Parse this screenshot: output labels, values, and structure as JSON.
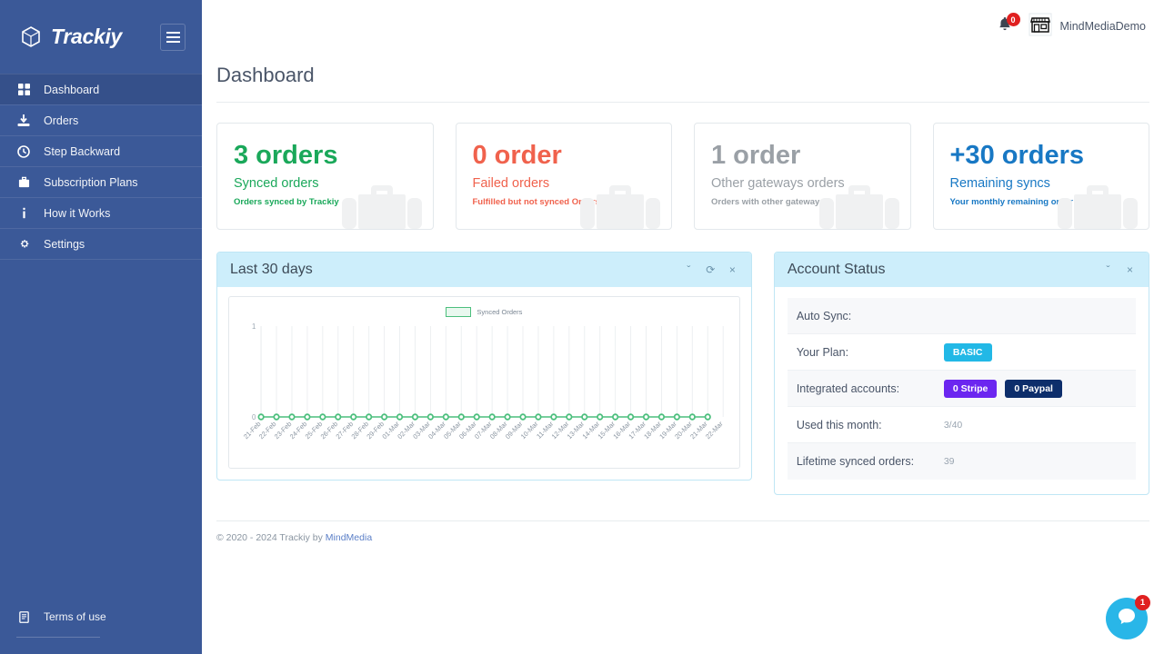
{
  "sidebar": {
    "brand": "Trackiy",
    "brand_logo_icon": "cube-logo-icon",
    "menu_toggle_icon": "hamburger-icon",
    "items": [
      {
        "label": "Dashboard",
        "icon": "grid-icon",
        "active": true
      },
      {
        "label": "Orders",
        "icon": "download-icon",
        "active": false
      },
      {
        "label": "Step Backward",
        "icon": "history-icon",
        "active": false
      },
      {
        "label": "Subscription Plans",
        "icon": "briefcase-icon",
        "active": false
      },
      {
        "label": "How it Works",
        "icon": "info-icon",
        "active": false
      },
      {
        "label": "Settings",
        "icon": "gear-icon",
        "active": false
      }
    ],
    "terms": {
      "label": "Terms of use",
      "icon": "document-icon"
    },
    "background_color": "#3b5998",
    "active_color": "#35508a"
  },
  "topbar": {
    "notification_icon": "bell-icon",
    "notification_count": "0",
    "shop_icon": "store-icon",
    "shop_name": "MindMediaDemo"
  },
  "page": {
    "title": "Dashboard"
  },
  "cards": [
    {
      "value": "3 orders",
      "label": "Synced orders",
      "sub": "Orders synced by Trackiy",
      "color": "#1aa85a",
      "icon": "briefcase-watermark-icon"
    },
    {
      "value": "0 order",
      "label": "Failed orders",
      "sub": "Fulfilled but not synced Orders.",
      "color": "#f0624d",
      "icon": "briefcase-watermark-icon"
    },
    {
      "value": "1 order",
      "label": "Other gateways orders",
      "sub": "Orders with other gateways.",
      "color": "#9aa0a6",
      "icon": "briefcase-watermark-icon"
    },
    {
      "value": "+30 orders",
      "label": "Remaining syncs",
      "sub": "Your monthly remaining order syncs.",
      "color": "#1878c4",
      "icon": "briefcase-watermark-icon"
    }
  ],
  "chart_panel": {
    "title": "Last 30 days",
    "tools": [
      {
        "name": "collapse-icon",
        "glyph": "ˇ"
      },
      {
        "name": "refresh-icon",
        "glyph": "⟳"
      },
      {
        "name": "close-icon",
        "glyph": "×"
      }
    ]
  },
  "chart_data": {
    "type": "line",
    "title": "Last 30 days",
    "xlabel": "",
    "ylabel": "",
    "ylim": [
      0,
      1
    ],
    "yticks": [
      "0",
      "1"
    ],
    "grid": true,
    "legend": {
      "position": "top-center",
      "entries": [
        "Synced Orders"
      ]
    },
    "series": [
      {
        "name": "Synced Orders",
        "color": "#4cbf7d",
        "fill": "#e9f8ef",
        "values": [
          0,
          0,
          0,
          0,
          0,
          0,
          0,
          0,
          0,
          0,
          0,
          0,
          0,
          0,
          0,
          0,
          0,
          0,
          0,
          0,
          0,
          0,
          0,
          0,
          0,
          0,
          0,
          0,
          0,
          0
        ]
      }
    ],
    "categories": [
      "21-Feb",
      "22-Feb",
      "23-Feb",
      "24-Feb",
      "25-Feb",
      "26-Feb",
      "27-Feb",
      "28-Feb",
      "29-Feb",
      "01-Mar",
      "02-Mar",
      "03-Mar",
      "04-Mar",
      "05-Mar",
      "06-Mar",
      "07-Mar",
      "08-Mar",
      "09-Mar",
      "10-Mar",
      "11-Mar",
      "12-Mar",
      "13-Mar",
      "14-Mar",
      "15-Mar",
      "16-Mar",
      "17-Mar",
      "18-Mar",
      "19-Mar",
      "20-Mar",
      "21-Mar",
      "22-Mar"
    ]
  },
  "status_panel": {
    "title": "Account Status",
    "tools": [
      {
        "name": "collapse-icon",
        "glyph": "ˇ"
      },
      {
        "name": "close-icon",
        "glyph": "×"
      }
    ],
    "rows": [
      {
        "key": "Auto Sync:",
        "badges": [],
        "value": ""
      },
      {
        "key": "Your Plan:",
        "badges": [
          {
            "text": "BASIC",
            "color": "#22b8e6"
          }
        ],
        "value": ""
      },
      {
        "key": "Integrated accounts:",
        "badges": [
          {
            "text": "0 Stripe",
            "color": "#6b26f0"
          },
          {
            "text": "0 Paypal",
            "color": "#0d2e6b"
          }
        ],
        "value": ""
      },
      {
        "key": "Used this month:",
        "badges": [],
        "value": "3/40"
      },
      {
        "key": "Lifetime synced orders:",
        "badges": [],
        "value": "39"
      }
    ]
  },
  "footer": {
    "text": "© 2020 - 2024 Trackiy by ",
    "link": "MindMedia"
  },
  "chat": {
    "icon": "chat-bubble-icon",
    "badge": "1",
    "color": "#29b6e8"
  }
}
